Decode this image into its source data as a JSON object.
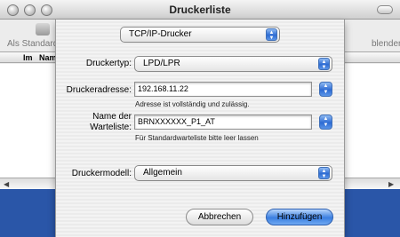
{
  "window": {
    "title": "Druckerliste",
    "toolbar_left": "Als Standard",
    "toolbar_right": "blenden",
    "columns": [
      "Im",
      "Nam"
    ]
  },
  "sheet": {
    "protocol_popup": "TCP/IP-Drucker",
    "printer_type_label": "Druckertyp:",
    "printer_type_value": "LPD/LPR",
    "address_label": "Druckeradresse:",
    "address_value": "192.168.11.22",
    "address_hint": "Adresse ist vollständig und zulässig.",
    "queue_label_line1": "Name der",
    "queue_label_line2": "Warteliste:",
    "queue_value": "BRNXXXXXX_P1_AT",
    "queue_hint": "Für Standardwarteliste bitte leer lassen",
    "model_label": "Druckermodell:",
    "model_value": "Allgemein",
    "cancel_label": "Abbrechen",
    "add_label": "Hinzufügen"
  },
  "colors": {
    "desktop": "#2a56a8",
    "aqua_blue": "#2d6bd3"
  }
}
